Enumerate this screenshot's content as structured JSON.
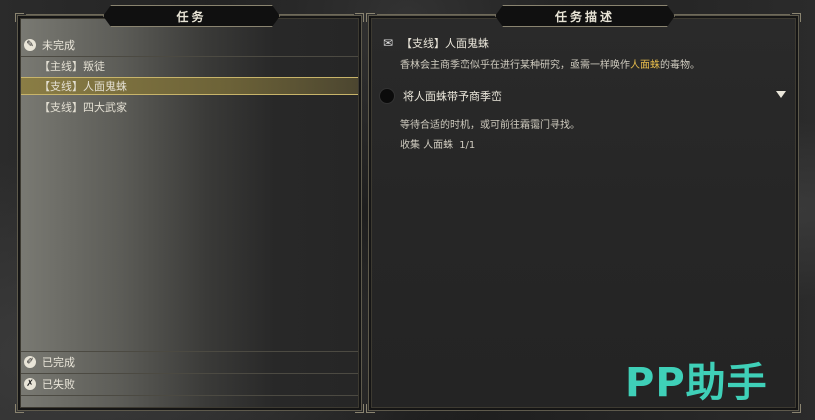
{
  "left_panel": {
    "title": "任务",
    "groups": {
      "incomplete": {
        "icon": "scroll-icon",
        "label": "未完成"
      },
      "completed": {
        "icon": "brush-icon",
        "label": "已完成"
      },
      "failed": {
        "icon": "broken-scroll-icon",
        "label": "已失败"
      }
    },
    "quests": [
      {
        "label": "【主线】叛徒",
        "selected": false
      },
      {
        "label": "【支线】人面鬼蛛",
        "selected": true
      },
      {
        "label": "【支线】四大武家",
        "selected": false
      }
    ]
  },
  "right_panel": {
    "title": "任务描述",
    "quest_title": "【支线】人面鬼蛛",
    "quest_icon": "quest-scroll-icon",
    "description_before": "香林会主商季峦似乎在进行某种研究，亟需一样唤作",
    "description_highlight": "人面蛛",
    "description_after": "的毒物。",
    "objective": "将人面蛛带予商季峦",
    "hint": "等待合适的时机，或可前往霜霭门寻找。",
    "progress_label": "收集 人面蛛",
    "progress_value": "1/1",
    "highlight_color": "#e3b94b"
  },
  "watermark": "PP助手"
}
